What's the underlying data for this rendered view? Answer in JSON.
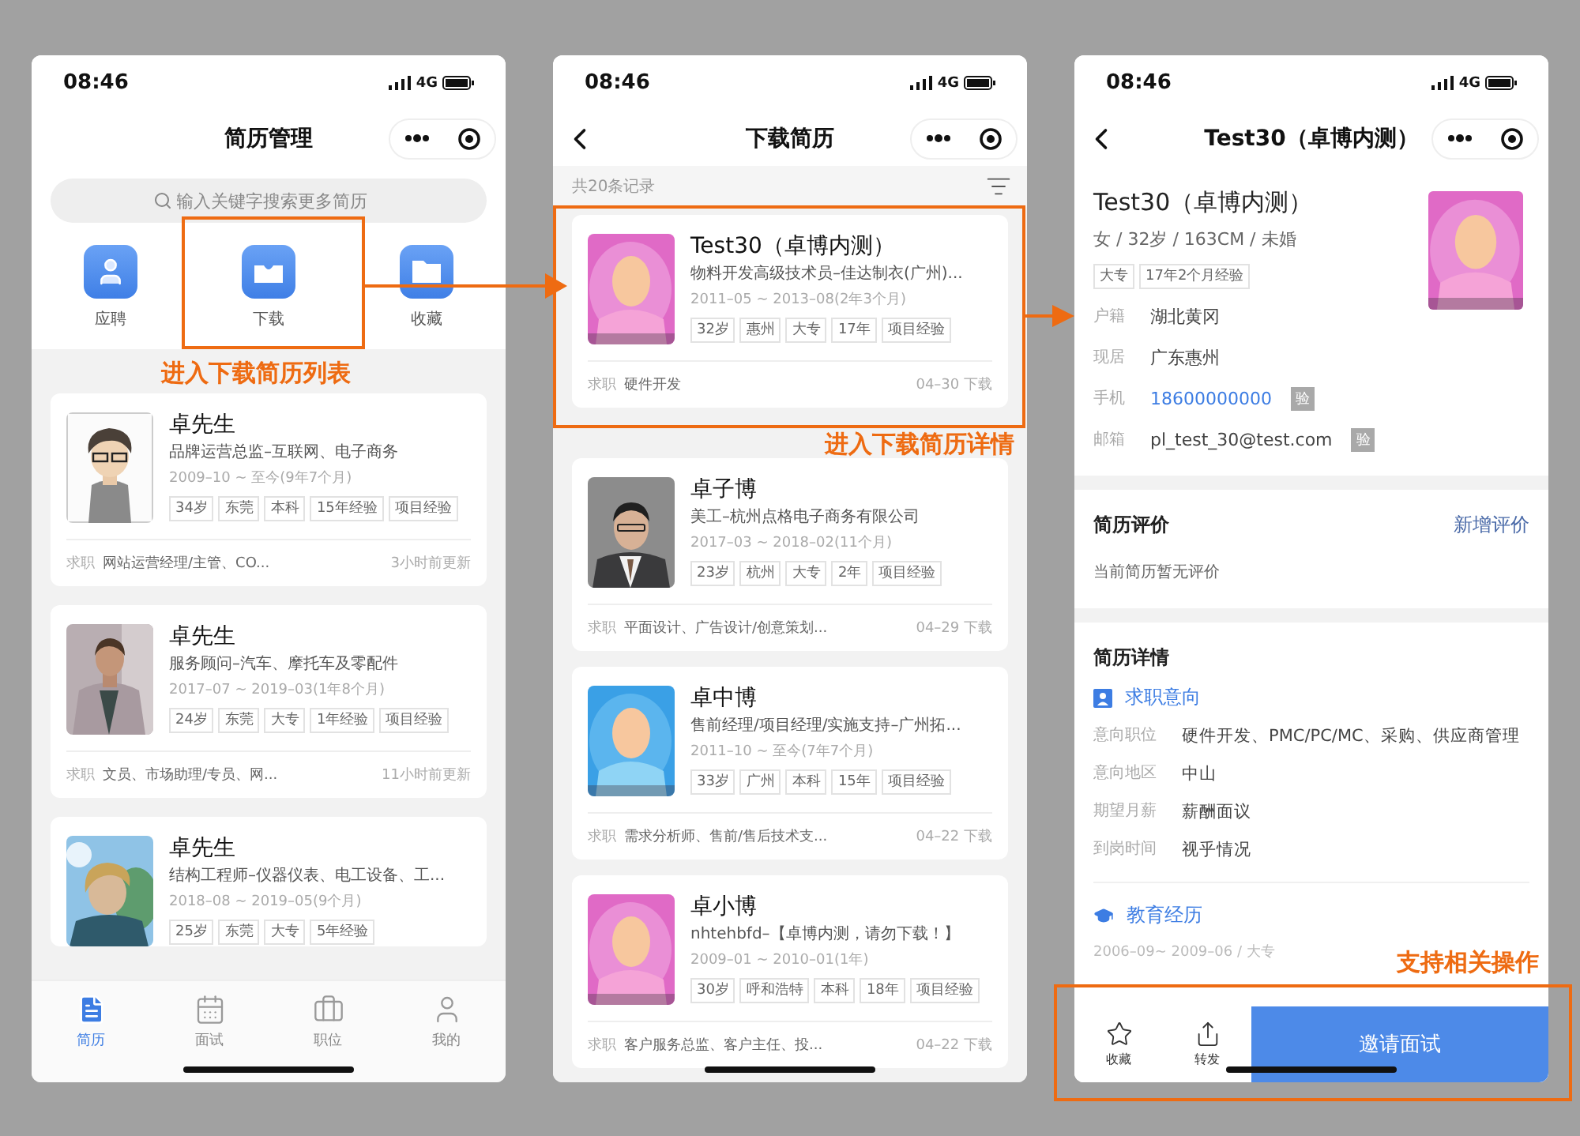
{
  "resume_management": {
    "status": {
      "time": "08:46",
      "network": "4G"
    },
    "title": "简历管理",
    "search": {
      "placeholder": "输入关键字搜索更多简历"
    },
    "shortcuts": [
      {
        "label": "应聘"
      },
      {
        "label": "下载"
      },
      {
        "label": "收藏"
      }
    ],
    "cards": [
      {
        "name": "卓先生",
        "headline": "品牌运营总监–互联网、电子商务",
        "period": "2009–10 ~ 至今(9年7个月)",
        "tags": [
          "34岁",
          "东莞",
          "本科",
          "15年经验",
          "项目经验"
        ],
        "job_label": "求职",
        "job": "网站运营经理/主管、CO...",
        "time": "3小时前更新"
      },
      {
        "name": "卓先生",
        "headline": "服务顾问–汽车、摩托车及零配件",
        "period": "2017–07 ~ 2019–03(1年8个月)",
        "tags": [
          "24岁",
          "东莞",
          "大专",
          "1年经验",
          "项目经验"
        ],
        "job_label": "求职",
        "job": "文员、市场助理/专员、网...",
        "time": "11小时前更新"
      },
      {
        "name": "卓先生",
        "headline": "结构工程师–仪器仪表、电工设备、工...",
        "period": "2018–08 ~ 2019–05(9个月)",
        "tags": [
          "25岁",
          "东莞",
          "大专",
          "5年经验"
        ]
      }
    ],
    "tabbar": [
      {
        "label": "简历",
        "selected": true
      },
      {
        "label": "面试",
        "selected": false
      },
      {
        "label": "职位",
        "selected": false
      },
      {
        "label": "我的",
        "selected": false
      }
    ]
  },
  "downloaded_resumes": {
    "status": {
      "time": "08:46",
      "network": "4G"
    },
    "title": "下载简历",
    "count": "共20条记录",
    "cards": [
      {
        "name": "Test30（卓博内测）",
        "headline": "物料开发高级技术员–佳达制衣(广州)...",
        "period": "2011–05 ~ 2013–08(2年3个月)",
        "tags": [
          "32岁",
          "惠州",
          "大专",
          "17年",
          "项目经验"
        ],
        "job_label": "求职",
        "job": "硬件开发",
        "time": "04–30 下载"
      },
      {
        "name": "卓子博",
        "headline": "美工–杭州点格电子商务有限公司",
        "period": "2017–03 ~ 2018–02(11个月)",
        "tags": [
          "23岁",
          "杭州",
          "大专",
          "2年",
          "项目经验"
        ],
        "job_label": "求职",
        "job": "平面设计、广告设计/创意策划...",
        "time": "04–29 下载"
      },
      {
        "name": "卓中博",
        "headline": "售前经理/项目经理/实施支持–广州拓...",
        "period": "2011–10 ~ 至今(7年7个月)",
        "tags": [
          "33岁",
          "广州",
          "本科",
          "15年",
          "项目经验"
        ],
        "job_label": "求职",
        "job": "需求分析师、售前/售后技术支...",
        "time": "04–22 下载"
      },
      {
        "name": "卓小博",
        "headline": "nhtehbfd–【卓博内测，请勿下载！】",
        "period": "2009–01 ~ 2010–01(1年)",
        "tags": [
          "30岁",
          "呼和浩特",
          "本科",
          "18年",
          "项目经验"
        ],
        "job_label": "求职",
        "job": "客户服务总监、客户主任、投...",
        "time": "04–22 下载"
      }
    ]
  },
  "resume_detail": {
    "status": {
      "time": "08:46",
      "network": "4G"
    },
    "title": "Test30（卓博内测）",
    "name": "Test30（卓博内测）",
    "info": "女 / 32岁 / 163CM / 未婚",
    "tags": [
      "大专",
      "17年2个月经验"
    ],
    "fields": [
      {
        "label": "户籍",
        "value": "湖北黄冈",
        "kind": "text"
      },
      {
        "label": "现居",
        "value": "广东惠州",
        "kind": "text"
      },
      {
        "label": "手机",
        "value": "18600000000",
        "kind": "link",
        "badge": "验"
      },
      {
        "label": "邮箱",
        "value": "pl_test_30@test.com",
        "kind": "text",
        "badge": "验"
      }
    ],
    "review": {
      "title": "简历评价",
      "action": "新增评价",
      "empty": "当前简历暂无评价"
    },
    "details": {
      "title": "简历详情",
      "intent": {
        "title": "求职意向",
        "rows": [
          {
            "label": "意向职位",
            "value": "硬件开发、PMC/PC/MC、采购、供应商管理"
          },
          {
            "label": "意向地区",
            "value": "中山"
          },
          {
            "label": "期望月薪",
            "value": "薪酬面议"
          },
          {
            "label": "到岗时间",
            "value": "视乎情况"
          }
        ]
      },
      "education": {
        "title": "教育经历",
        "line": "2006–09~ 2009–06 / 大专"
      }
    },
    "actions": [
      {
        "label": "收藏",
        "kind": "star"
      },
      {
        "label": "转发",
        "kind": "share"
      }
    ],
    "primary_action": "邀请面试"
  },
  "annotations": [
    {
      "label": "进入下载简历列表"
    },
    {
      "label": "进入下载简历详情"
    },
    {
      "label": "支持相关操作"
    }
  ]
}
